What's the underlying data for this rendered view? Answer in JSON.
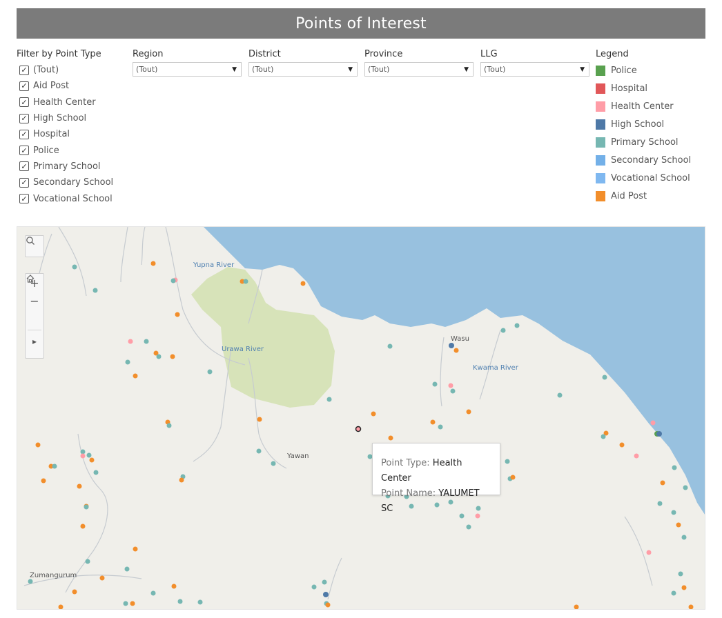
{
  "title": "Points of Interest",
  "filter": {
    "title": "Filter by Point Type",
    "items": [
      {
        "label": "(Tout)",
        "checked": true
      },
      {
        "label": "Aid Post",
        "checked": true
      },
      {
        "label": "Health Center",
        "checked": true
      },
      {
        "label": "High School",
        "checked": true
      },
      {
        "label": "Hospital",
        "checked": true
      },
      {
        "label": "Police",
        "checked": true
      },
      {
        "label": "Primary School",
        "checked": true
      },
      {
        "label": "Secondary School",
        "checked": true
      },
      {
        "label": "Vocational School",
        "checked": true
      }
    ]
  },
  "dropdowns": [
    {
      "label": "Region",
      "value": "(Tout)"
    },
    {
      "label": "District",
      "value": "(Tout)"
    },
    {
      "label": "Province",
      "value": "(Tout)"
    },
    {
      "label": "LLG",
      "value": "(Tout)"
    }
  ],
  "legend": {
    "title": "Legend",
    "items": [
      {
        "label": "Police",
        "color": "#59a14f"
      },
      {
        "label": "Hospital",
        "color": "#e15759"
      },
      {
        "label": "Health Center",
        "color": "#ff9da7"
      },
      {
        "label": "High School",
        "color": "#4e79a7"
      },
      {
        "label": "Primary School",
        "color": "#76b7b2"
      },
      {
        "label": "Secondary School",
        "color": "#73b0e8"
      },
      {
        "label": "Vocational School",
        "color": "#7fb8f0"
      },
      {
        "label": "Aid Post",
        "color": "#f28e2b"
      }
    ]
  },
  "map": {
    "controls": [
      "search-icon",
      "zoom-in-icon",
      "zoom-out-icon",
      "home-icon",
      "expand-arrow-icon"
    ],
    "zoom_in": "+",
    "zoom_out": "−",
    "expand": "▸",
    "labels": {
      "yupna": "Yupna River",
      "urawa": "Urawa River",
      "wasu": "Wasu",
      "kwama": "Kwama River",
      "yawan": "Yawan",
      "zumangurum": "Zumangurum"
    },
    "colors": {
      "land": "#f0efea",
      "sea": "#98c1df",
      "park": "#d7e3b9",
      "river": "#c6cbd0"
    }
  },
  "tooltip": {
    "type_label": "Point Type:",
    "type_value": "Health Center",
    "name_label": "Point Name:",
    "name_value": "YALUMET SC"
  }
}
